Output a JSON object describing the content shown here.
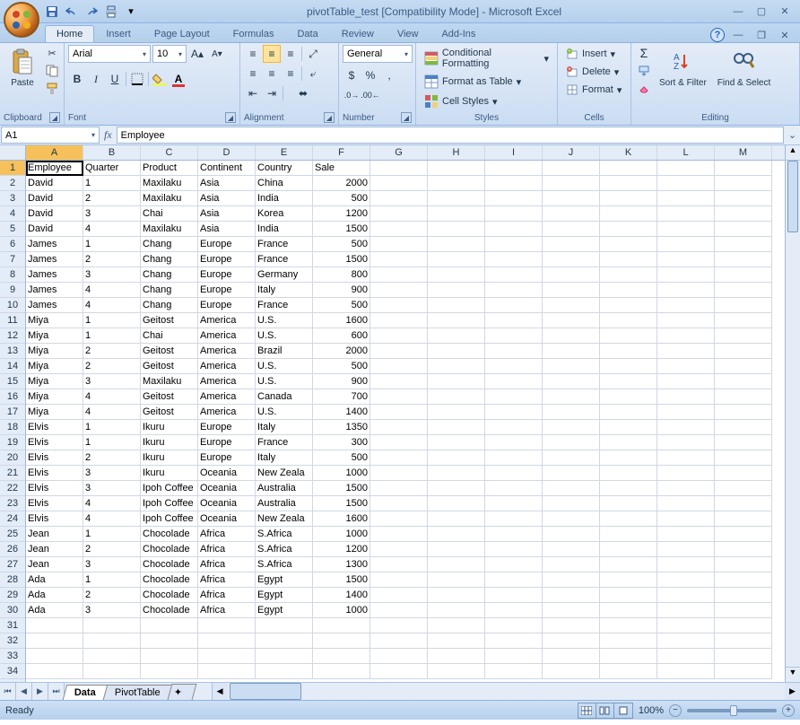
{
  "title": "pivotTable_test  [Compatibility Mode] - Microsoft Excel",
  "tabs": [
    "Home",
    "Insert",
    "Page Layout",
    "Formulas",
    "Data",
    "Review",
    "View",
    "Add-Ins"
  ],
  "active_tab": "Home",
  "clipboard": {
    "paste": "Paste",
    "label": "Clipboard"
  },
  "font": {
    "name": "Arial",
    "size": "10",
    "label": "Font",
    "bold": "B",
    "italic": "I",
    "underline": "U"
  },
  "alignment": {
    "label": "Alignment"
  },
  "number": {
    "format": "General",
    "label": "Number",
    "currency": "$",
    "percent": "%",
    "comma": ",",
    "inc": ".0",
    "dec": ".00"
  },
  "styles": {
    "cond": "Conditional Formatting",
    "table": "Format as Table",
    "cell": "Cell Styles",
    "label": "Styles"
  },
  "cells": {
    "insert": "Insert",
    "delete": "Delete",
    "format": "Format",
    "label": "Cells"
  },
  "editing": {
    "sum": "Σ",
    "sort": "Sort & Filter",
    "find": "Find & Select",
    "label": "Editing"
  },
  "name_box": "A1",
  "formula": "Employee",
  "columns": [
    "A",
    "B",
    "C",
    "D",
    "E",
    "F",
    "G",
    "H",
    "I",
    "J",
    "K",
    "L",
    "M"
  ],
  "rows_visible": 34,
  "grid": [
    [
      "Employee",
      "Quarter",
      "Product",
      "Continent",
      "Country",
      "Sale"
    ],
    [
      "David",
      "1",
      "Maxilaku",
      "Asia",
      "China",
      "2000"
    ],
    [
      "David",
      "2",
      "Maxilaku",
      "Asia",
      "India",
      "500"
    ],
    [
      "David",
      "3",
      "Chai",
      "Asia",
      "Korea",
      "1200"
    ],
    [
      "David",
      "4",
      "Maxilaku",
      "Asia",
      "India",
      "1500"
    ],
    [
      "James",
      "1",
      "Chang",
      "Europe",
      "France",
      "500"
    ],
    [
      "James",
      "2",
      "Chang",
      "Europe",
      "France",
      "1500"
    ],
    [
      "James",
      "3",
      "Chang",
      "Europe",
      "Germany",
      "800"
    ],
    [
      "James",
      "4",
      "Chang",
      "Europe",
      "Italy",
      "900"
    ],
    [
      "James",
      "4",
      "Chang",
      "Europe",
      "France",
      "500"
    ],
    [
      "Miya",
      "1",
      "Geitost",
      "America",
      "U.S.",
      "1600"
    ],
    [
      "Miya",
      "1",
      "Chai",
      "America",
      "U.S.",
      "600"
    ],
    [
      "Miya",
      "2",
      "Geitost",
      "America",
      "Brazil",
      "2000"
    ],
    [
      "Miya",
      "2",
      "Geitost",
      "America",
      "U.S.",
      "500"
    ],
    [
      "Miya",
      "3",
      "Maxilaku",
      "America",
      "U.S.",
      "900"
    ],
    [
      "Miya",
      "4",
      "Geitost",
      "America",
      "Canada",
      "700"
    ],
    [
      "Miya",
      "4",
      "Geitost",
      "America",
      "U.S.",
      "1400"
    ],
    [
      "Elvis",
      "1",
      "Ikuru",
      "Europe",
      "Italy",
      "1350"
    ],
    [
      "Elvis",
      "1",
      "Ikuru",
      "Europe",
      "France",
      "300"
    ],
    [
      "Elvis",
      "2",
      "Ikuru",
      "Europe",
      "Italy",
      "500"
    ],
    [
      "Elvis",
      "3",
      "Ikuru",
      "Oceania",
      "New Zeala",
      "1000"
    ],
    [
      "Elvis",
      "3",
      "Ipoh Coffee",
      "Oceania",
      "Australia",
      "1500"
    ],
    [
      "Elvis",
      "4",
      "Ipoh Coffee",
      "Oceania",
      "Australia",
      "1500"
    ],
    [
      "Elvis",
      "4",
      "Ipoh Coffee",
      "Oceania",
      "New Zeala",
      "1600"
    ],
    [
      "Jean",
      "1",
      "Chocolade",
      "Africa",
      "S.Africa",
      "1000"
    ],
    [
      "Jean",
      "2",
      "Chocolade",
      "Africa",
      "S.Africa",
      "1200"
    ],
    [
      "Jean",
      "3",
      "Chocolade",
      "Africa",
      "S.Africa",
      "1300"
    ],
    [
      "Ada",
      "1",
      "Chocolade",
      "Africa",
      "Egypt",
      "1500"
    ],
    [
      "Ada",
      "2",
      "Chocolade",
      "Africa",
      "Egypt",
      "1400"
    ],
    [
      "Ada",
      "3",
      "Chocolade",
      "Africa",
      "Egypt",
      "1000"
    ]
  ],
  "sheets": [
    "Data",
    "PivotTable"
  ],
  "active_sheet": "Data",
  "status": "Ready",
  "zoom": "100%"
}
